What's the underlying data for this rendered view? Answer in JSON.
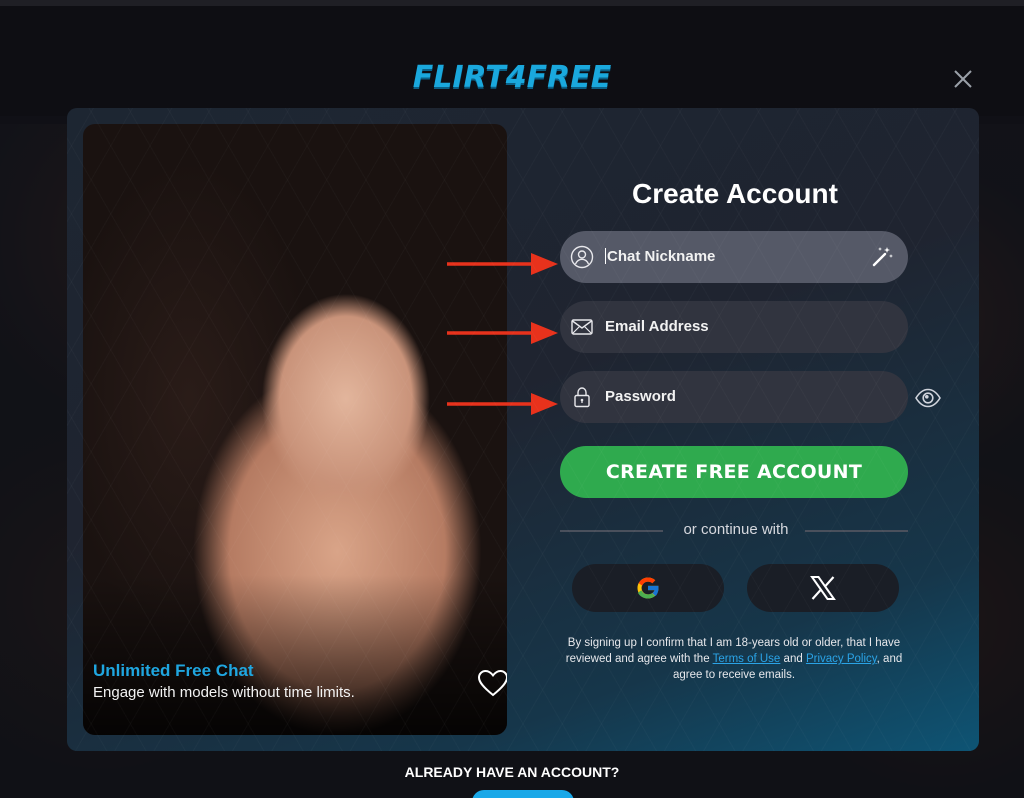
{
  "brand": {
    "logo_text": "FLIRT4FREE",
    "accent_color": "#1aa8dd"
  },
  "modal": {
    "title": "Create Account",
    "promo": {
      "title": "Unlimited Free Chat",
      "subtitle": "Engage with models without time limits."
    },
    "fields": {
      "nickname": {
        "placeholder": "Chat Nickname",
        "icon": "user-icon",
        "action_icon": "magic-wand-icon"
      },
      "email": {
        "placeholder": "Email Address",
        "icon": "envelope-icon"
      },
      "password": {
        "placeholder": "Password",
        "icon": "lock-icon",
        "toggle_icon": "eye-icon"
      }
    },
    "submit_label": "CREATE FREE ACCOUNT",
    "submit_color": "#2faa4e",
    "divider_text": "or continue with",
    "social": [
      {
        "provider": "Google",
        "icon": "google-icon"
      },
      {
        "provider": "X",
        "icon": "x-icon"
      }
    ],
    "legal": {
      "prefix": "By signing up I confirm that I am 18-years old or older, that I have reviewed and agree with the",
      "terms_link": "Terms of Use",
      "and": "and",
      "privacy_link": "Privacy Policy",
      "suffix": ", and agree to receive emails."
    },
    "annotation_color": "#e8321c"
  },
  "footer": {
    "already_text": "ALREADY HAVE AN ACCOUNT?"
  }
}
